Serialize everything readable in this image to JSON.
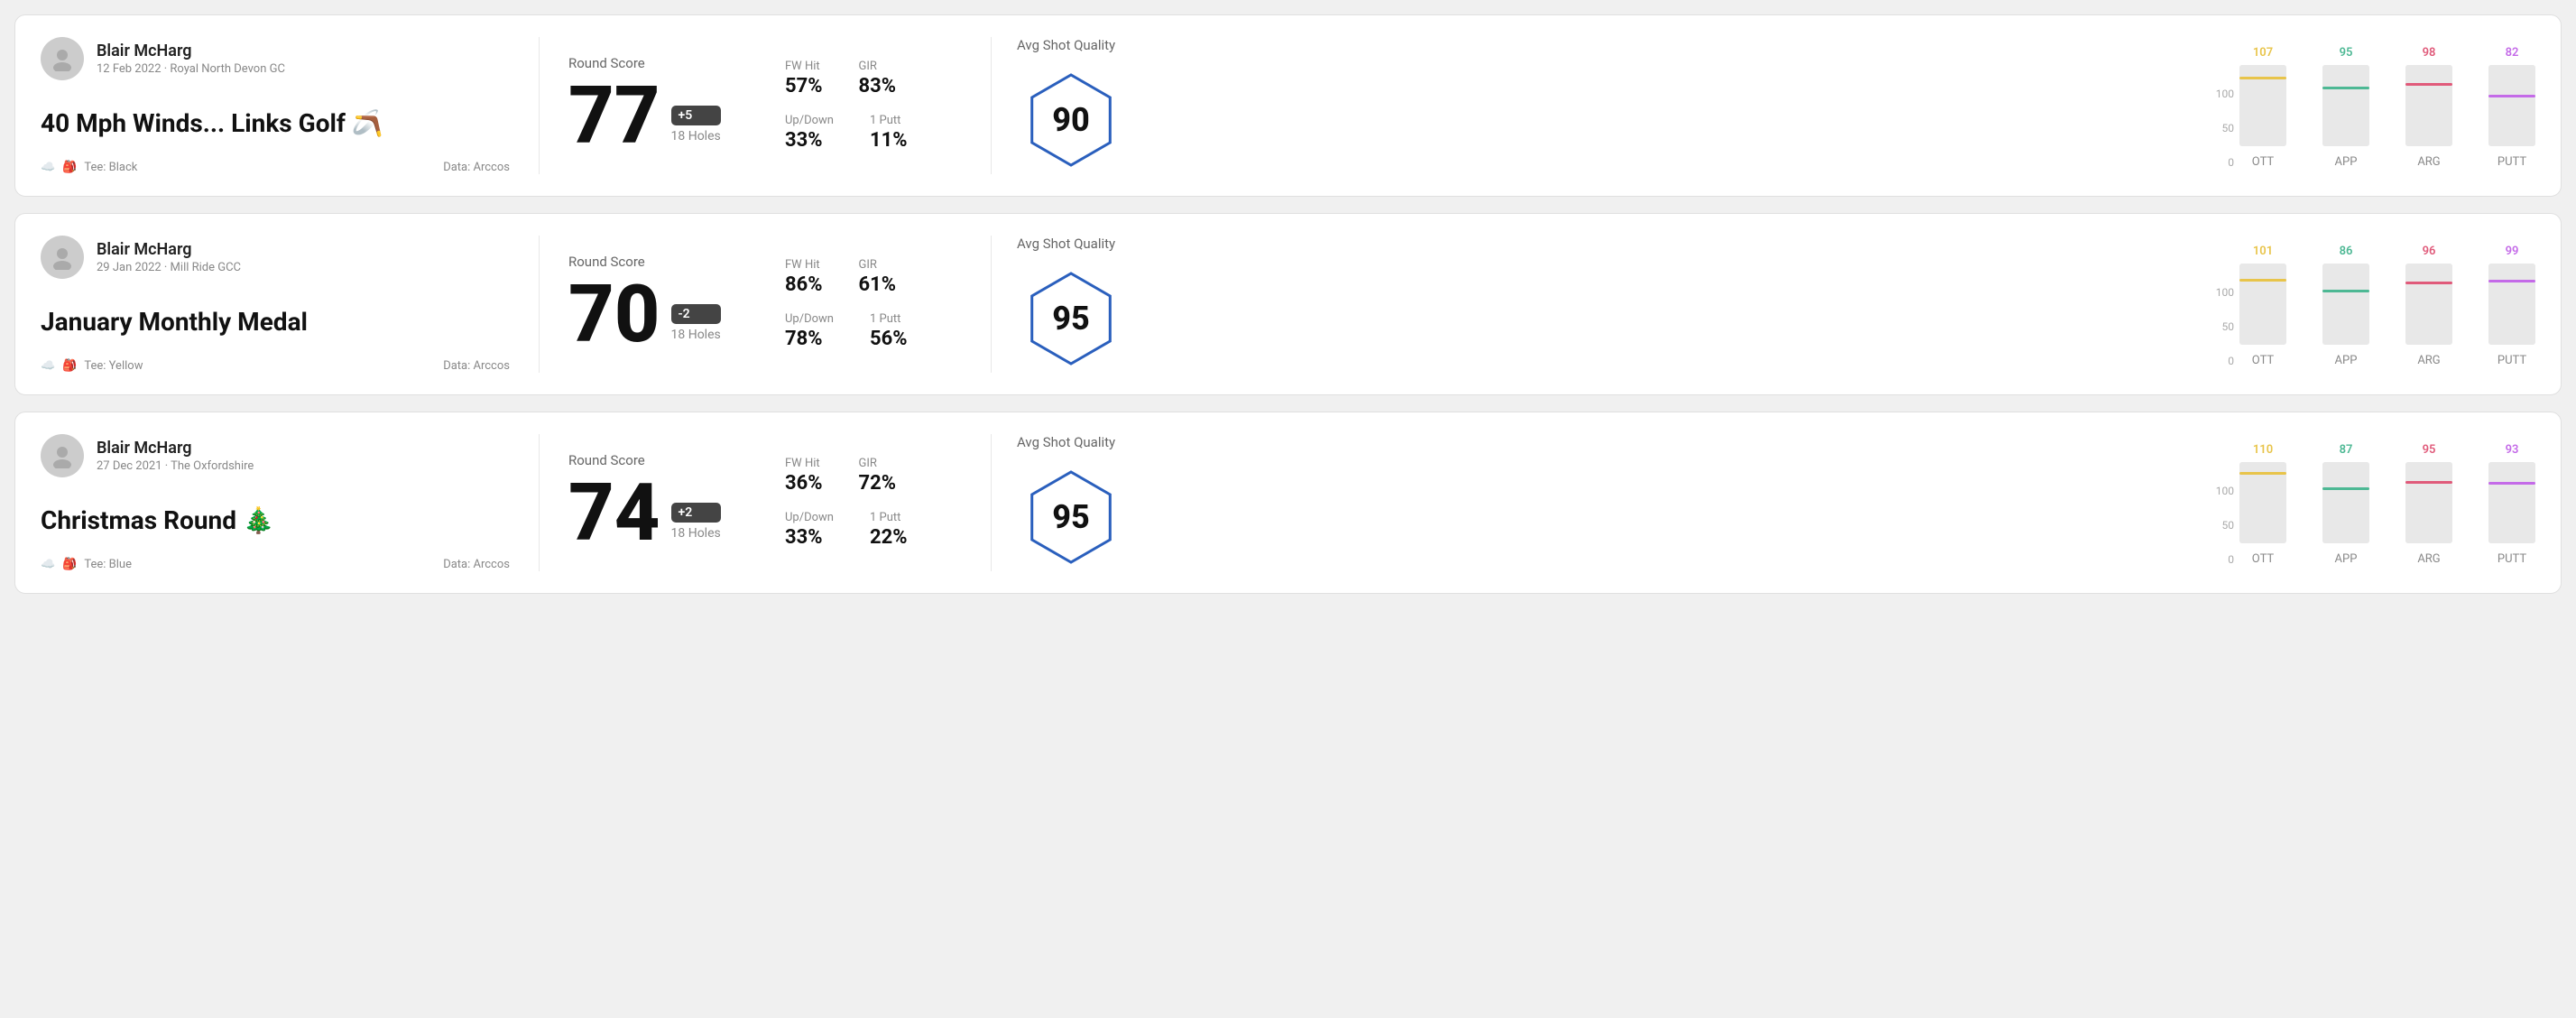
{
  "rounds": [
    {
      "id": "round1",
      "user_name": "Blair McHarg",
      "user_meta": "12 Feb 2022 · Royal North Devon GC",
      "round_title": "40 Mph Winds... Links Golf 🪃",
      "tee": "Tee: Black",
      "data_source": "Data: Arccos",
      "score": "77",
      "score_diff": "+5",
      "holes": "18 Holes",
      "fw_hit_label": "FW Hit",
      "fw_hit_value": "57%",
      "gir_label": "GIR",
      "gir_value": "83%",
      "updown_label": "Up/Down",
      "updown_value": "33%",
      "oneputt_label": "1 Putt",
      "oneputt_value": "11%",
      "quality_label": "Avg Shot Quality",
      "quality_value": "90",
      "chart_bars": [
        {
          "label": "OTT",
          "value": 107,
          "color": "#e8c44a",
          "pct": 82
        },
        {
          "label": "APP",
          "value": 95,
          "color": "#4db894",
          "pct": 70
        },
        {
          "label": "ARG",
          "value": 98,
          "color": "#e05a7a",
          "pct": 75
        },
        {
          "label": "PUTT",
          "value": 82,
          "color": "#c46ae8",
          "pct": 60
        }
      ]
    },
    {
      "id": "round2",
      "user_name": "Blair McHarg",
      "user_meta": "29 Jan 2022 · Mill Ride GCC",
      "round_title": "January Monthly Medal",
      "tee": "Tee: Yellow",
      "data_source": "Data: Arccos",
      "score": "70",
      "score_diff": "-2",
      "holes": "18 Holes",
      "fw_hit_label": "FW Hit",
      "fw_hit_value": "86%",
      "gir_label": "GIR",
      "gir_value": "61%",
      "updown_label": "Up/Down",
      "updown_value": "78%",
      "oneputt_label": "1 Putt",
      "oneputt_value": "56%",
      "quality_label": "Avg Shot Quality",
      "quality_value": "95",
      "chart_bars": [
        {
          "label": "OTT",
          "value": 101,
          "color": "#e8c44a",
          "pct": 78
        },
        {
          "label": "APP",
          "value": 86,
          "color": "#4db894",
          "pct": 65
        },
        {
          "label": "ARG",
          "value": 96,
          "color": "#e05a7a",
          "pct": 74
        },
        {
          "label": "PUTT",
          "value": 99,
          "color": "#c46ae8",
          "pct": 77
        }
      ]
    },
    {
      "id": "round3",
      "user_name": "Blair McHarg",
      "user_meta": "27 Dec 2021 · The Oxfordshire",
      "round_title": "Christmas Round 🎄",
      "tee": "Tee: Blue",
      "data_source": "Data: Arccos",
      "score": "74",
      "score_diff": "+2",
      "holes": "18 Holes",
      "fw_hit_label": "FW Hit",
      "fw_hit_value": "36%",
      "gir_label": "GIR",
      "gir_value": "72%",
      "updown_label": "Up/Down",
      "updown_value": "33%",
      "oneputt_label": "1 Putt",
      "oneputt_value": "22%",
      "quality_label": "Avg Shot Quality",
      "quality_value": "95",
      "chart_bars": [
        {
          "label": "OTT",
          "value": 110,
          "color": "#e8c44a",
          "pct": 85
        },
        {
          "label": "APP",
          "value": 87,
          "color": "#4db894",
          "pct": 66
        },
        {
          "label": "ARG",
          "value": 95,
          "color": "#e05a7a",
          "pct": 73
        },
        {
          "label": "PUTT",
          "value": 93,
          "color": "#c46ae8",
          "pct": 72
        }
      ]
    }
  ],
  "y_axis_labels": [
    "100",
    "50",
    "0"
  ]
}
